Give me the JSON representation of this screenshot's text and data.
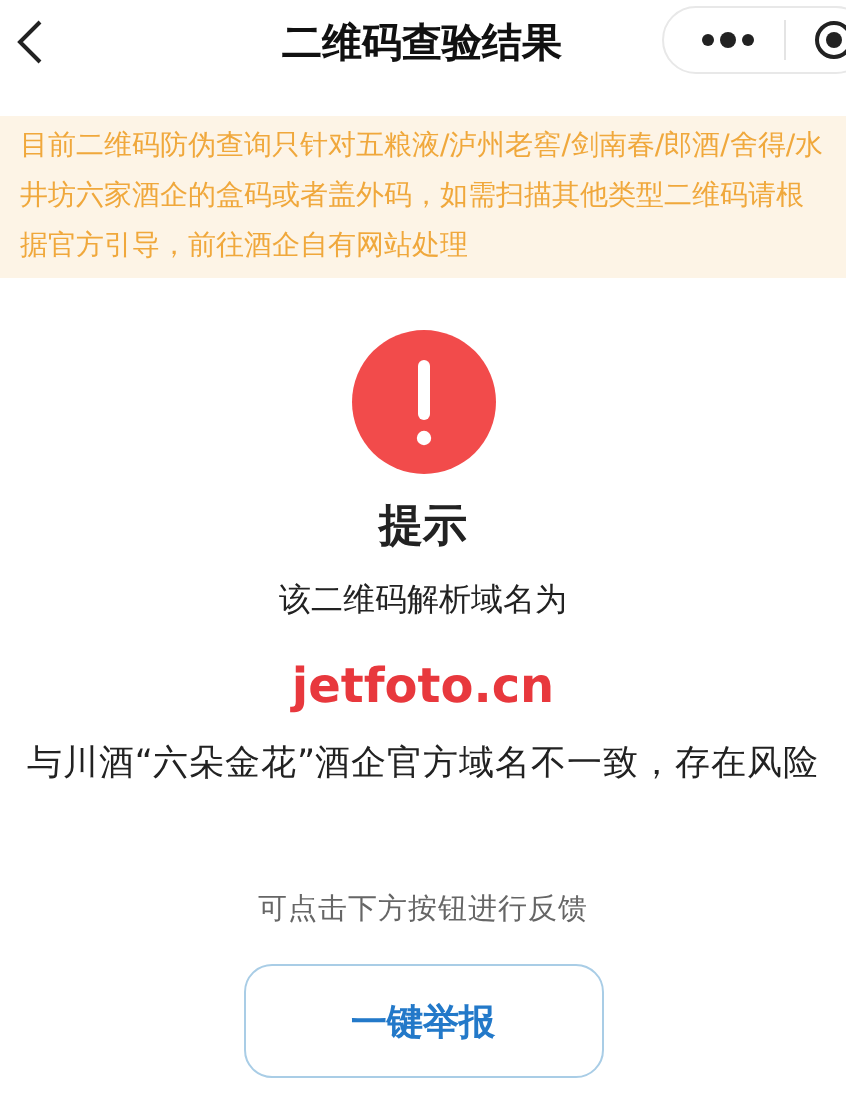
{
  "nav_bar": {
    "title": "二维码查验结果"
  },
  "notice": {
    "text": "目前二维码防伪查询只针对五粮液/泸州老窖/剑南春/郎酒/舍得/水井坊六家酒企的盒码或者盖外码，如需扫描其他类型二维码请根据官方引导，前往酒企自有网站处理"
  },
  "result": {
    "heading": "提示",
    "domain_label": "该二维码解析域名为",
    "domain": "jetfoto.cn",
    "warning": "与川酒“六朵金花”酒企官方域名不一致，存在风险",
    "feedback_hint": "可点击下方按钮进行反馈"
  },
  "buttons": [
    {
      "label": "一键举报"
    }
  ]
}
